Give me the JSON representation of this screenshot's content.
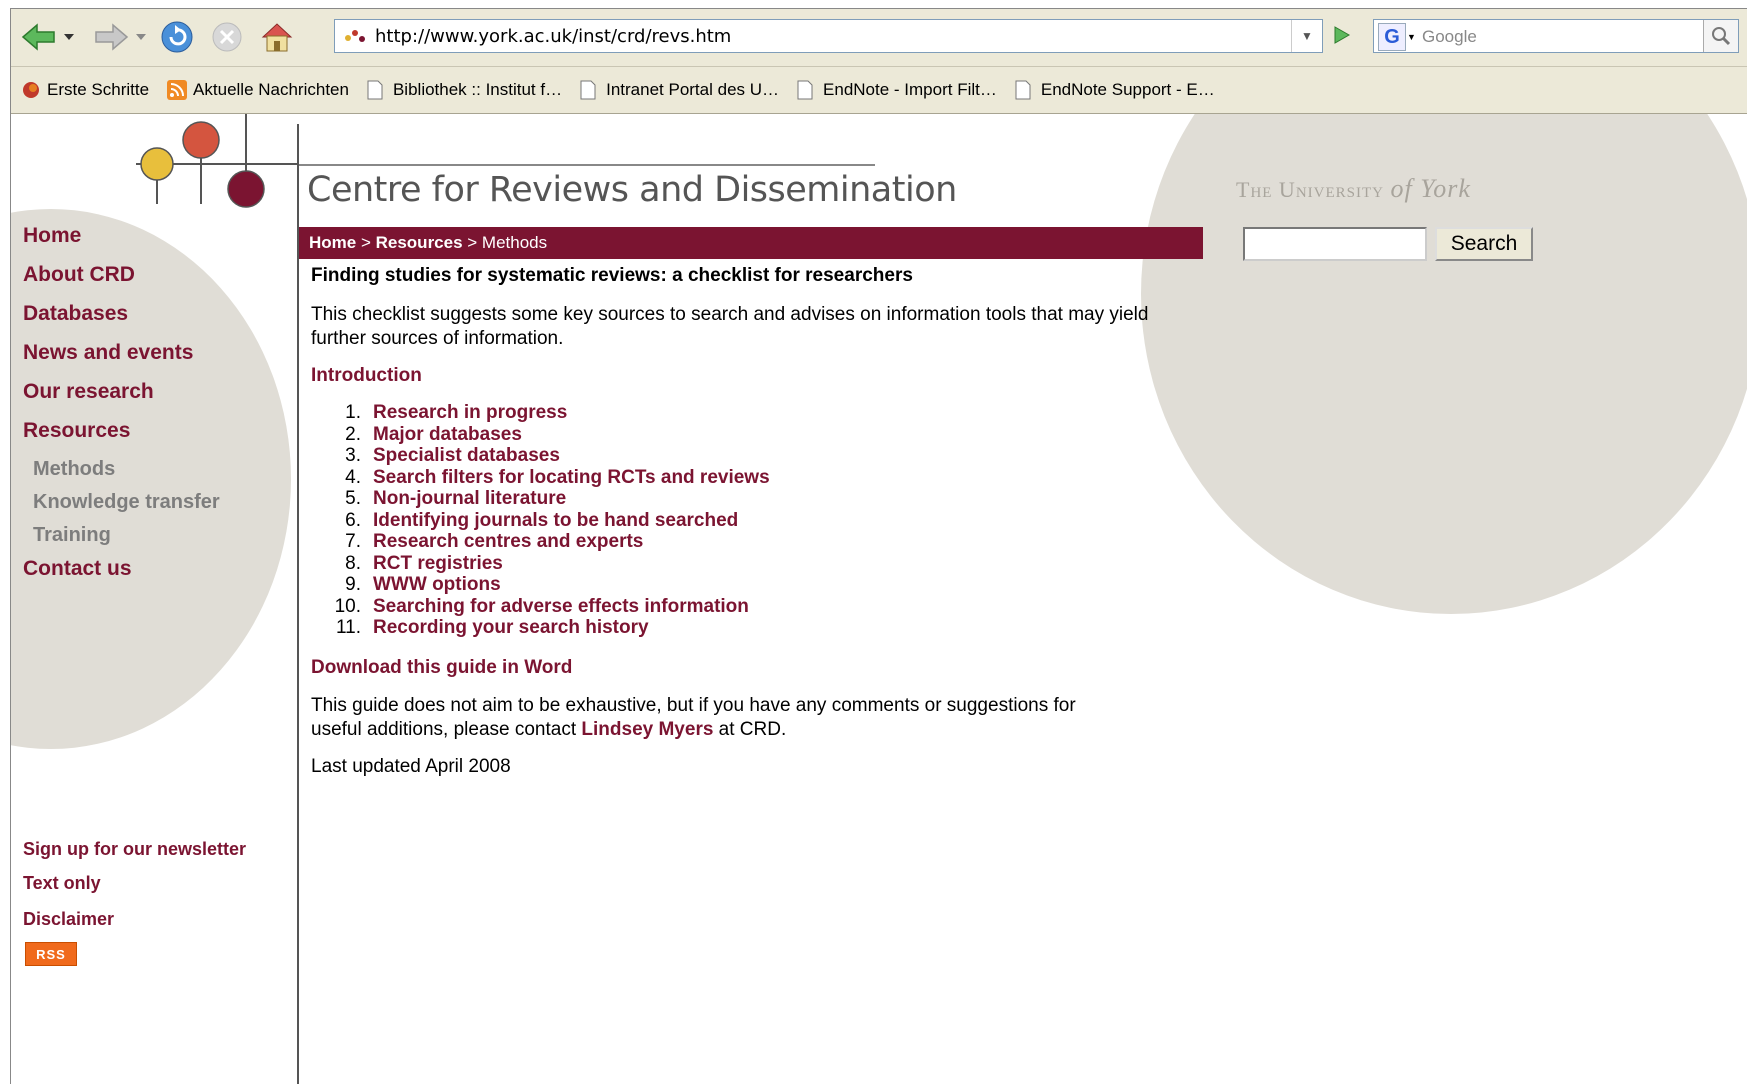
{
  "browser": {
    "url": "http://www.york.ac.uk/inst/crd/revs.htm",
    "search_placeholder": "Google",
    "bookmarks": [
      "Erste Schritte",
      "Aktuelle Nachrichten",
      "Bibliothek :: Institut f…",
      "Intranet Portal des U…",
      "EndNote - Import Filt…",
      "EndNote Support - E…"
    ]
  },
  "site": {
    "title": "Centre for Reviews and Dissemination",
    "university": "The University",
    "university_of": "of York",
    "search_button": "Search",
    "breadcrumb": {
      "home": "Home",
      "sep1": " > ",
      "resources": "Resources",
      "sep2": " > ",
      "current": "Methods"
    }
  },
  "nav": {
    "items": [
      "Home",
      "About CRD",
      "Databases",
      "News and events",
      "Our research",
      "Resources"
    ],
    "subitems": [
      "Methods",
      "Knowledge transfer",
      "Training"
    ],
    "contact": "Contact us",
    "footer": [
      "Sign up for our newsletter",
      "Text only",
      "Disclaimer"
    ],
    "rss": "RSS"
  },
  "main": {
    "heading": "Finding studies for systematic reviews: a checklist for researchers",
    "intro": "This checklist suggests some key sources to search and advises on information tools that may yield further sources of information.",
    "introduction_link": "Introduction",
    "list": [
      "Research in progress",
      "Major databases",
      "Specialist databases",
      "Search filters for locating RCTs and reviews",
      "Non-journal literature",
      "Identifying journals to be hand searched",
      "Research centres and experts",
      "RCT registries",
      "WWW options",
      "Searching for adverse effects information",
      "Recording your search history"
    ],
    "download_link": "Download this guide in Word",
    "comments_pre": "This guide does not aim to be exhaustive, but if you have any comments or suggestions for useful additions, please contact ",
    "contact_name": "Lindsey Myers",
    "comments_post": " at CRD.",
    "updated": "Last updated April 2008"
  },
  "colors": {
    "maroon": "#7b1431",
    "circle": "#e0ddd6",
    "sub_nav": "#7d7d7d",
    "rss": "#f06a1c"
  }
}
